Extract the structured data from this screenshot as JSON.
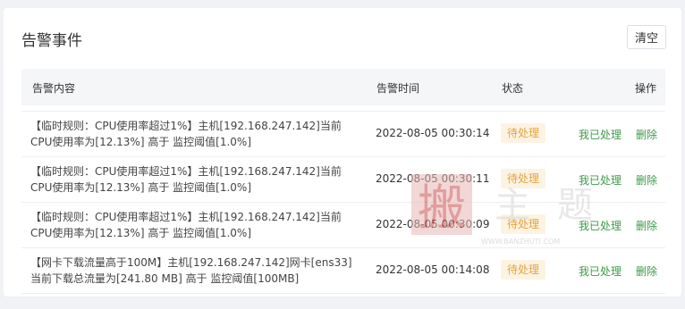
{
  "panel": {
    "title": "告警事件",
    "clear_label": "清空"
  },
  "table": {
    "headers": {
      "content": "告警内容",
      "time": "告警时间",
      "status": "状态",
      "action": "操作"
    },
    "rows": [
      {
        "content": "【临时规则：CPU使用率超过1%】主机[192.168.247.142]当前CPU使用率为[12.13%] 高于 监控阈值[1.0%]",
        "time": "2022-08-05 00:30:14",
        "status": "待处理",
        "handled": "我已处理",
        "delete": "删除"
      },
      {
        "content": "【临时规则：CPU使用率超过1%】主机[192.168.247.142]当前CPU使用率为[12.13%] 高于 监控阈值[1.0%]",
        "time": "2022-08-05 00:30:11",
        "status": "待处理",
        "handled": "我已处理",
        "delete": "删除"
      },
      {
        "content": "【临时规则：CPU使用率超过1%】主机[192.168.247.142]当前CPU使用率为[12.13%] 高于 监控阈值[1.0%]",
        "time": "2022-08-05 00:30:09",
        "status": "待处理",
        "handled": "我已处理",
        "delete": "删除"
      },
      {
        "content": "【网卡下载流量高于100M】主机[192.168.247.142]网卡[ens33] 当前下载总流量为[241.80 MB] 高于 监控阈值[100MB]",
        "time": "2022-08-05 00:14:08",
        "status": "待处理",
        "handled": "我已处理",
        "delete": "删除"
      }
    ]
  },
  "watermark": {
    "text": "搬主题",
    "url": "WWW.BANZHUTI.COM"
  },
  "colors": {
    "badge_bg": "#fdf3e3",
    "badge_text": "#e6a23c",
    "action": "#3e9b47"
  }
}
